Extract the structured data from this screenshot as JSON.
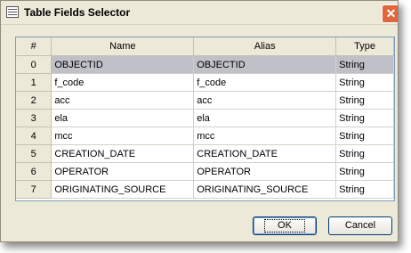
{
  "window": {
    "title": "Table Fields Selector",
    "close_glyph": "✕"
  },
  "grid": {
    "columns": [
      "#",
      "Name",
      "Alias",
      "Type"
    ],
    "rows": [
      {
        "num": "0",
        "name": "OBJECTID",
        "alias": "OBJECTID",
        "type": "String"
      },
      {
        "num": "1",
        "name": "f_code",
        "alias": "f_code",
        "type": "String"
      },
      {
        "num": "2",
        "name": "acc",
        "alias": "acc",
        "type": "String"
      },
      {
        "num": "3",
        "name": "ela",
        "alias": "ela",
        "type": "String"
      },
      {
        "num": "4",
        "name": "mcc",
        "alias": "mcc",
        "type": "String"
      },
      {
        "num": "5",
        "name": "CREATION_DATE",
        "alias": "CREATION_DATE",
        "type": "String"
      },
      {
        "num": "6",
        "name": "OPERATOR",
        "alias": "OPERATOR",
        "type": "String"
      },
      {
        "num": "7",
        "name": "ORIGINATING_SOURCE",
        "alias": "ORIGINATING_SOURCE",
        "type": "String"
      }
    ],
    "selected_row": "0"
  },
  "buttons": {
    "ok_label": "OK",
    "cancel_label": "Cancel"
  },
  "colors": {
    "selection": "#c0c0c8",
    "dialog_bg": "#ece9d8",
    "close_button": "#e0663c"
  }
}
